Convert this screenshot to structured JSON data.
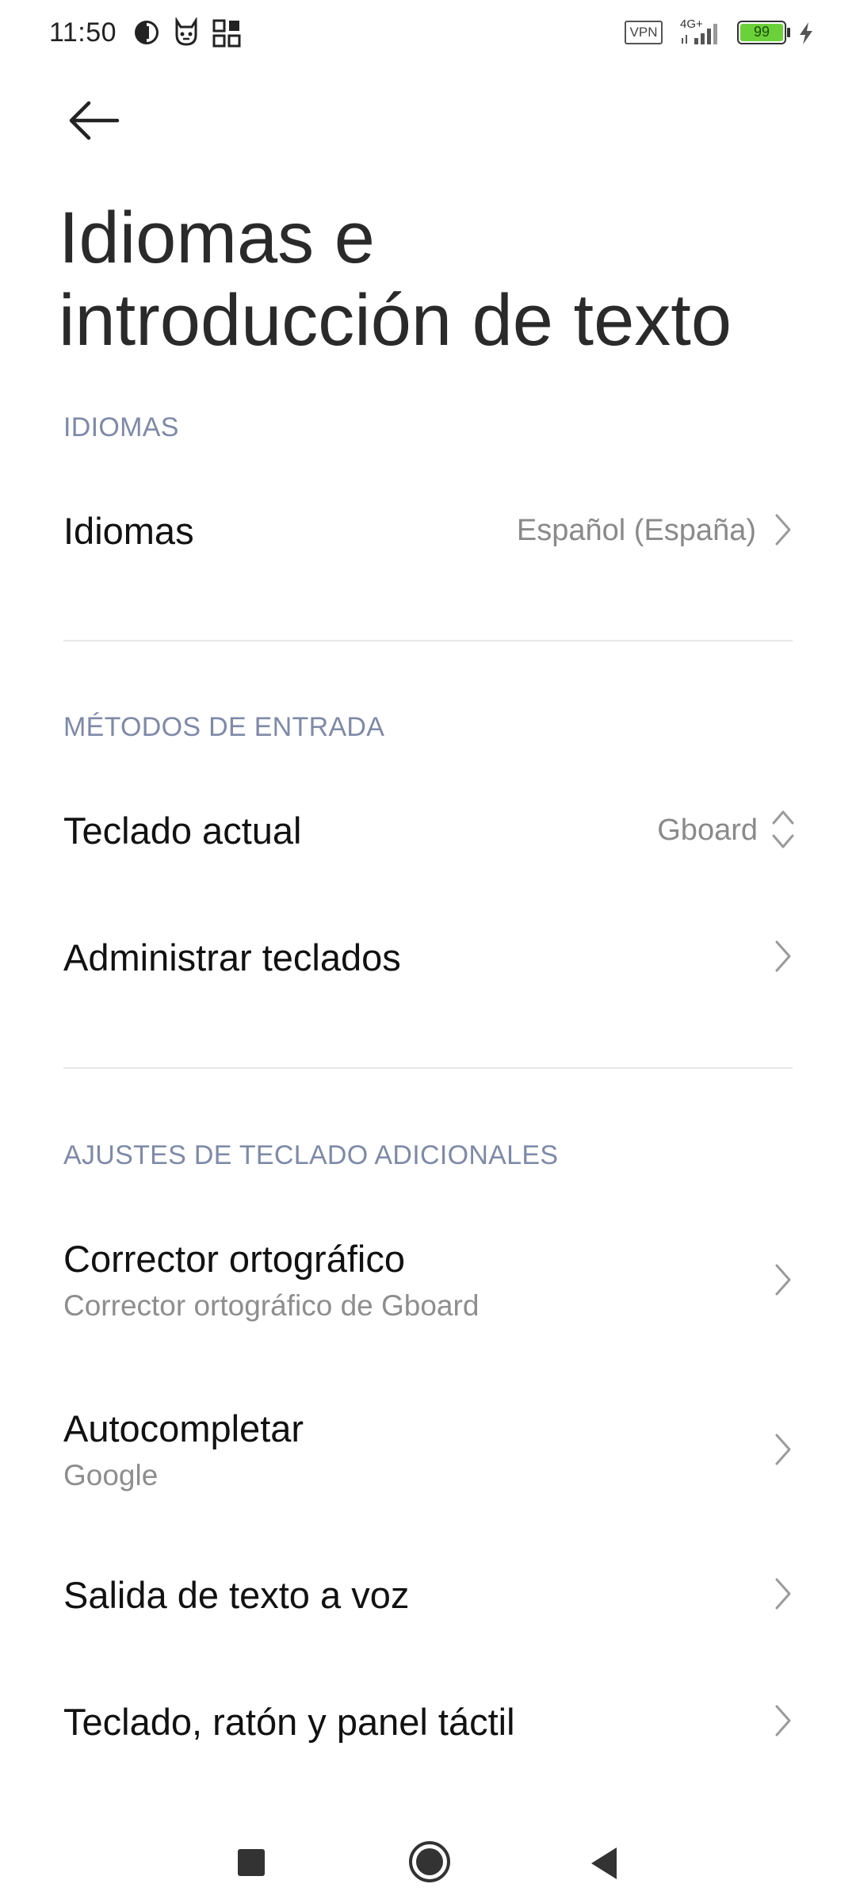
{
  "status_bar": {
    "time": "11:50",
    "vpn_label": "VPN",
    "network_label": "4G+",
    "battery": "99",
    "icons": [
      "pie-status-icon",
      "cat-face-icon",
      "qr-grid-icon",
      "vpn-icon",
      "signal-icon",
      "battery-icon",
      "charging-bolt-icon"
    ]
  },
  "header": {
    "back_icon": "arrow-left-icon",
    "title_line1": "Idiomas e",
    "title_line2": "introducción de texto"
  },
  "sections": {
    "idiomas": {
      "header": "IDIOMAS",
      "languages": {
        "title": "Idiomas",
        "value": "Español (España)"
      }
    },
    "input_methods": {
      "header": "MÉTODOS DE ENTRADA",
      "current_keyboard": {
        "title": "Teclado actual",
        "value": "Gboard"
      },
      "manage_keyboards": {
        "title": "Administrar teclados"
      }
    },
    "additional": {
      "header": "AJUSTES DE TECLADO ADICIONALES",
      "spell_checker": {
        "title": "Corrector ortográfico",
        "subtitle": "Corrector ortográfico de Gboard"
      },
      "autofill": {
        "title": "Autocompletar",
        "subtitle": "Google"
      },
      "tts": {
        "title": "Salida de texto a voz"
      },
      "keyboard_mouse": {
        "title": "Teclado, ratón y panel táctil"
      }
    }
  },
  "nav_bar": {
    "icons": [
      "recents-square-icon",
      "home-circle-icon",
      "back-triangle-icon"
    ]
  },
  "colors": {
    "section_header": "#7f8aa8",
    "battery_fill": "#6bd13a",
    "divider": "#e8e8e8"
  }
}
